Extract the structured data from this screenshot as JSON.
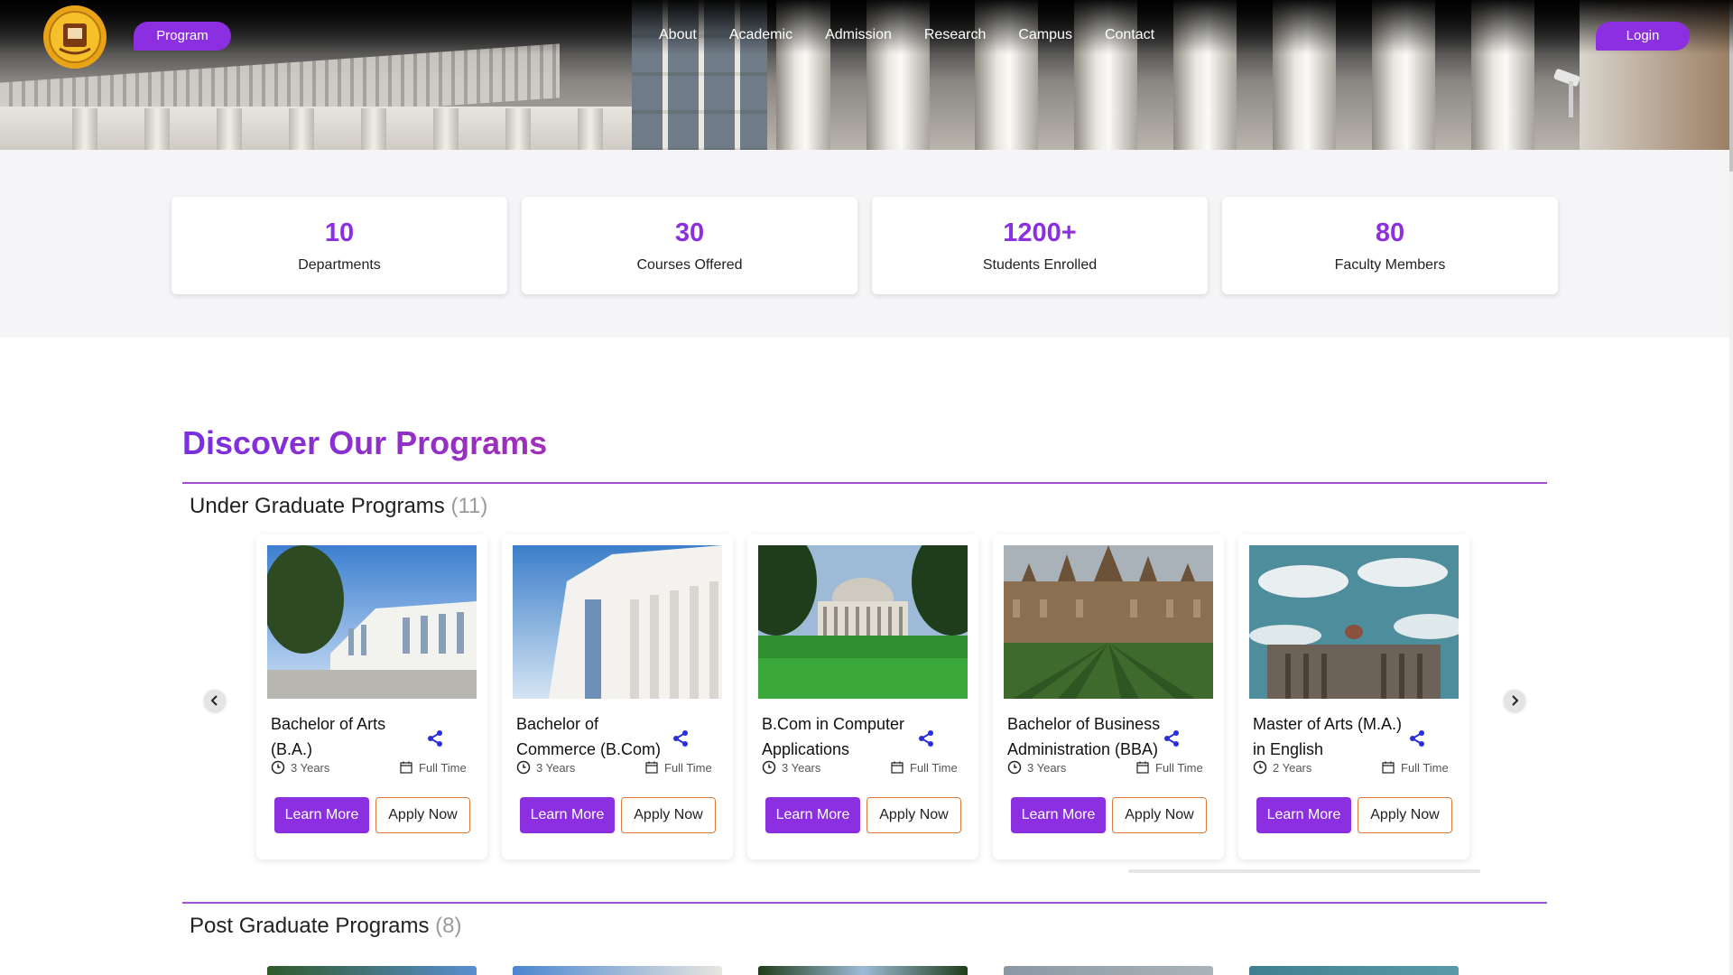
{
  "header": {
    "program_label": "Program",
    "login_label": "Login",
    "nav": [
      "About",
      "Academic",
      "Admission",
      "Research",
      "Campus",
      "Contact"
    ]
  },
  "stats": [
    {
      "value": "10",
      "label": "Departments"
    },
    {
      "value": "30",
      "label": "Courses Offered"
    },
    {
      "value": "1200+",
      "label": "Students Enrolled"
    },
    {
      "value": "80",
      "label": "Faculty Members"
    }
  ],
  "programs": {
    "title": "Discover Our Programs",
    "ug": {
      "heading": "Under Graduate Programs",
      "count": "(11)",
      "cards": [
        {
          "title": "Bachelor of Arts (B.A.)",
          "duration": "3 Years",
          "type": "Full Time",
          "learn": "Learn More",
          "apply": "Apply Now"
        },
        {
          "title": "Bachelor of Commerce (B.Com)",
          "duration": "3 Years",
          "type": "Full Time",
          "learn": "Learn More",
          "apply": "Apply Now"
        },
        {
          "title": "B.Com in Computer Applications",
          "duration": "3 Years",
          "type": "Full Time",
          "learn": "Learn More",
          "apply": "Apply Now"
        },
        {
          "title": "Bachelor of Business Administration (BBA)",
          "duration": "3 Years",
          "type": "Full Time",
          "learn": "Learn More",
          "apply": "Apply Now"
        },
        {
          "title": "Master of Arts (M.A.) in English",
          "duration": "2 Years",
          "type": "Full Time",
          "learn": "Learn More",
          "apply": "Apply Now"
        }
      ]
    },
    "pg": {
      "heading": "Post Graduate Programs",
      "count": "(8)"
    }
  },
  "colors": {
    "accent": "#8b2fe0",
    "apply_border": "#e07a3a",
    "share_icon": "#2b2fd6"
  },
  "icons": {
    "logo": "university-seal-logo",
    "share": "share-icon",
    "clock": "clock-icon",
    "calendar": "calendar-icon",
    "prev": "chevron-left-icon",
    "next": "chevron-right-icon"
  }
}
